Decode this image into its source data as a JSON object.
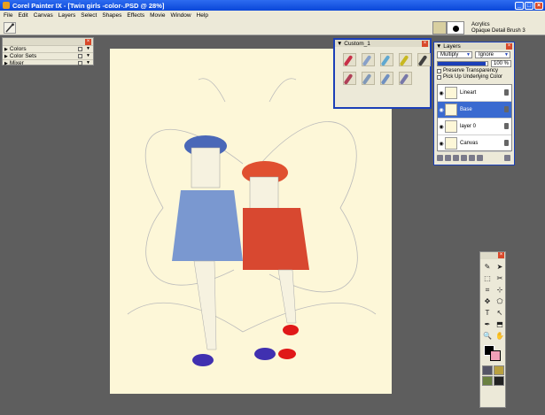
{
  "window": {
    "title": "Corel Painter IX - [Twin girls -color-.PSD @ 28%]",
    "buttons": {
      "minimize": "_",
      "maximize": "□",
      "close": "×"
    }
  },
  "menu": [
    "File",
    "Edit",
    "Canvas",
    "Layers",
    "Select",
    "Shapes",
    "Effects",
    "Movie",
    "Window",
    "Help"
  ],
  "property_bar": {
    "brush_category": "Acrylics",
    "brush_variant": "Opaque Detail Brush 3"
  },
  "colors_panel": {
    "items": [
      "Colors",
      "Color Sets",
      "Mixer"
    ]
  },
  "custom_panel": {
    "title": "Custom_1",
    "brush_colors": [
      "#c83048",
      "#88a0c8",
      "#60a8d0",
      "#c8b820",
      "#404040",
      "#b04058",
      "#8098b8",
      "#7090c0",
      "#7878a8"
    ]
  },
  "layers_panel": {
    "title": "Layers",
    "composite_method": "Multiply",
    "composite_depth": "Ignore",
    "opacity": "100 %",
    "opacity_fraction": 0.96,
    "preserve_transparency": "Preserve Transparency",
    "pick_up_underlying": "Pick Up Underlying Color",
    "layers": [
      {
        "name": "Lineart",
        "selected": false
      },
      {
        "name": "Base",
        "selected": true
      },
      {
        "name": "layer 0",
        "selected": false
      },
      {
        "name": "Canvas",
        "selected": false
      }
    ]
  },
  "toolbox": {
    "tool_glyphs": [
      "✎",
      "➤",
      "⬚",
      "✂",
      "⌗",
      "⊹",
      "✥",
      "⬠",
      "T",
      "↖",
      "✒",
      "⬒",
      "🔍",
      "✋"
    ],
    "main_color": "#000000",
    "additional_color": "#f0a0b8"
  }
}
